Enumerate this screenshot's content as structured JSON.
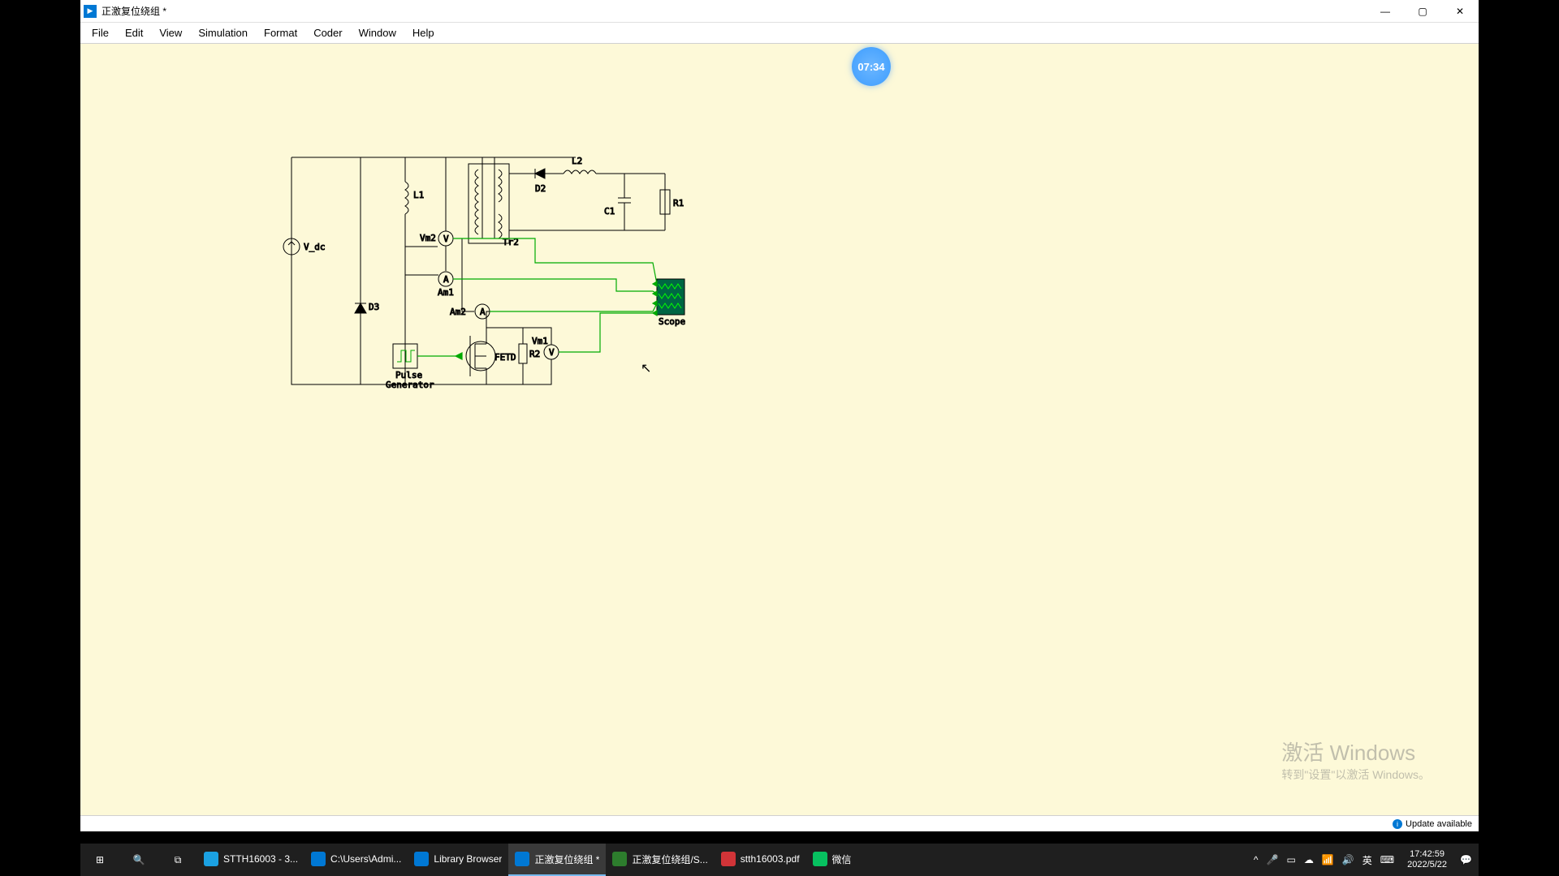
{
  "window": {
    "title": "正激复位绕组 *",
    "menus": [
      "File",
      "Edit",
      "View",
      "Simulation",
      "Format",
      "Coder",
      "Window",
      "Help"
    ]
  },
  "timer": "07:34",
  "labels": {
    "V_dc": "V_dc",
    "L1": "L1",
    "D3": "D3",
    "Vm2": "Vm2",
    "Am1": "Am1",
    "Am2": "Am2",
    "Tr2": "Tr2",
    "D2": "D2",
    "L2": "L2",
    "C1": "C1",
    "R1": "R1",
    "Scope": "Scope",
    "Pulse": "Pulse",
    "Generator": "Generator",
    "FET": "FETD",
    "R2": "R2",
    "Vm1": "Vm1"
  },
  "watermark": {
    "l1": "激活 Windows",
    "l2": "转到\"设置\"以激活 Windows。"
  },
  "status": "Update available",
  "taskbar": {
    "tasks": [
      {
        "label": "STTH16003 - 3...",
        "color": "#1ba1e2"
      },
      {
        "label": "C:\\Users\\Admi...",
        "color": "#0078d4"
      },
      {
        "label": "Library Browser",
        "color": "#0078d4"
      },
      {
        "label": "正激复位绕组 *",
        "color": "#0078d4",
        "active": true
      },
      {
        "label": "正激复位绕组/S...",
        "color": "#2d7d2d"
      },
      {
        "label": "stth16003.pdf",
        "color": "#d13438"
      },
      {
        "label": "微信",
        "color": "#07c160"
      }
    ],
    "tray": {
      "ime": "英",
      "kb": "⌨",
      "time": "17:42:59",
      "date": "2022/5/22"
    }
  }
}
